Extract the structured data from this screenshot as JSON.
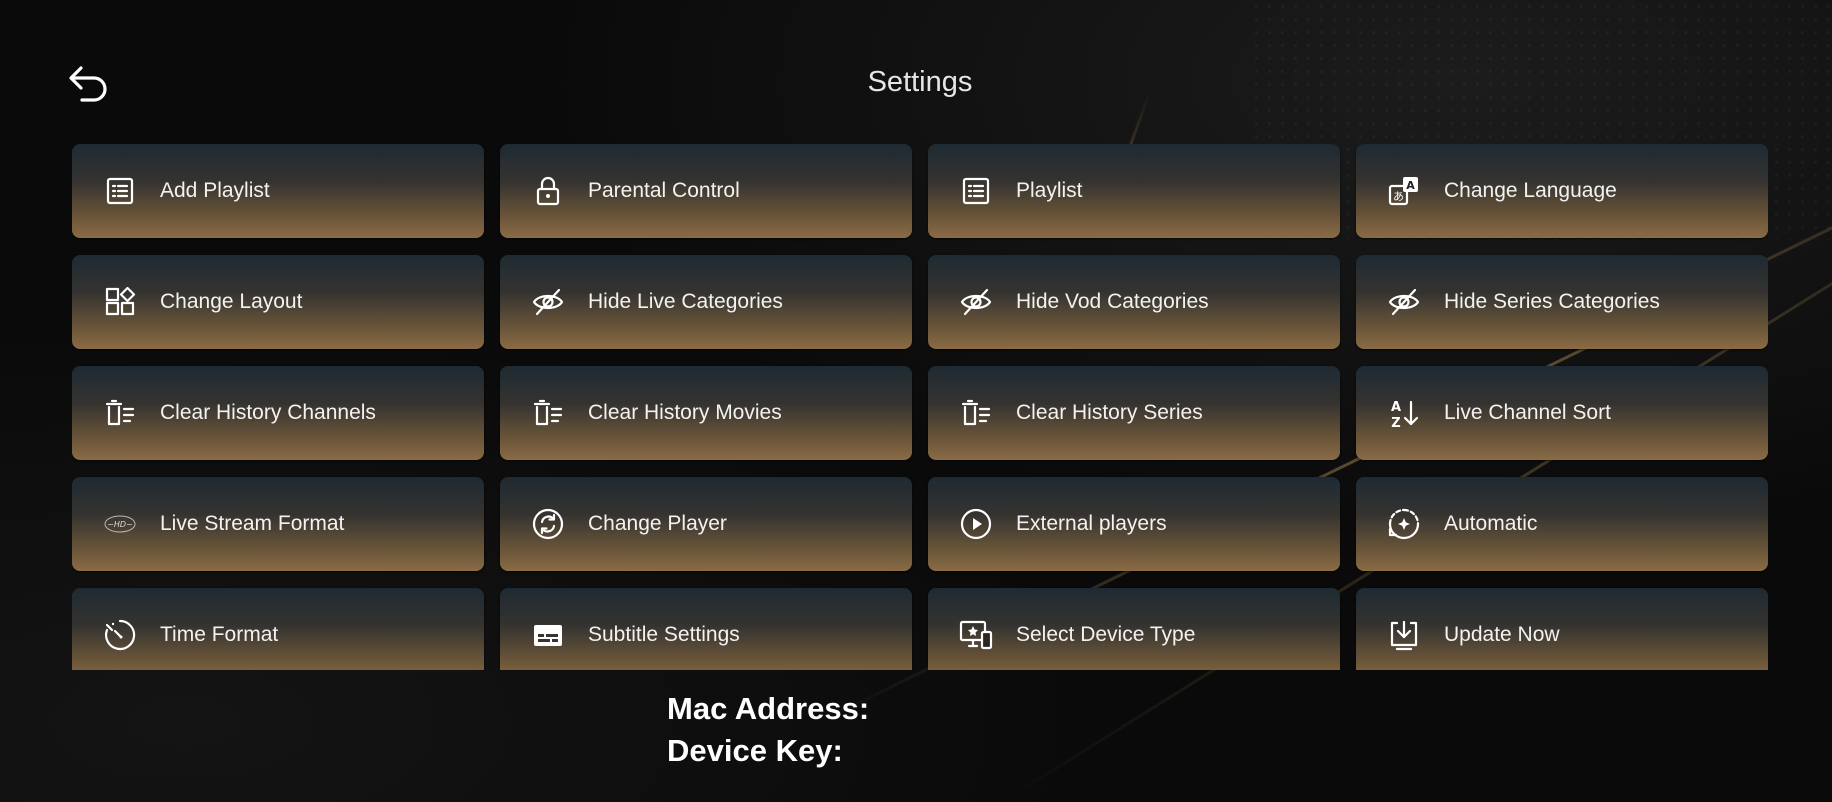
{
  "header": {
    "title": "Settings",
    "back_icon": "back-arrow-icon"
  },
  "tiles": [
    {
      "label": "Add Playlist",
      "icon": "list-icon"
    },
    {
      "label": "Parental Control",
      "icon": "lock-icon"
    },
    {
      "label": "Playlist",
      "icon": "list-icon"
    },
    {
      "label": "Change Language",
      "icon": "translate-icon"
    },
    {
      "label": "Change Layout",
      "icon": "layout-icon"
    },
    {
      "label": "Hide Live Categories",
      "icon": "eye-off-icon"
    },
    {
      "label": "Hide Vod Categories",
      "icon": "eye-off-icon"
    },
    {
      "label": "Hide Series Categories",
      "icon": "eye-off-icon"
    },
    {
      "label": "Clear History Channels",
      "icon": "trash-list-icon"
    },
    {
      "label": "Clear History Movies",
      "icon": "trash-list-icon"
    },
    {
      "label": "Clear History Series",
      "icon": "trash-list-icon"
    },
    {
      "label": "Live Channel Sort",
      "icon": "sort-az-icon"
    },
    {
      "label": "Live Stream Format",
      "icon": "stream-format-icon"
    },
    {
      "label": "Change Player",
      "icon": "refresh-circle-icon"
    },
    {
      "label": "External players",
      "icon": "play-circle-icon"
    },
    {
      "label": "Automatic",
      "icon": "auto-icon"
    },
    {
      "label": "Time Format",
      "icon": "timer-icon"
    },
    {
      "label": "Subtitle Settings",
      "icon": "subtitles-icon"
    },
    {
      "label": "Select Device Type",
      "icon": "devices-icon"
    },
    {
      "label": "Update Now",
      "icon": "download-icon"
    }
  ],
  "device_info": {
    "mac_label": "Mac Address:",
    "mac_value": "",
    "key_label": "Device Key:",
    "key_value": ""
  },
  "colors": {
    "tile_top": "#1e2a33",
    "tile_bottom": "#8a6b45",
    "background": "#0b0b0b",
    "text": "#ffffff"
  }
}
